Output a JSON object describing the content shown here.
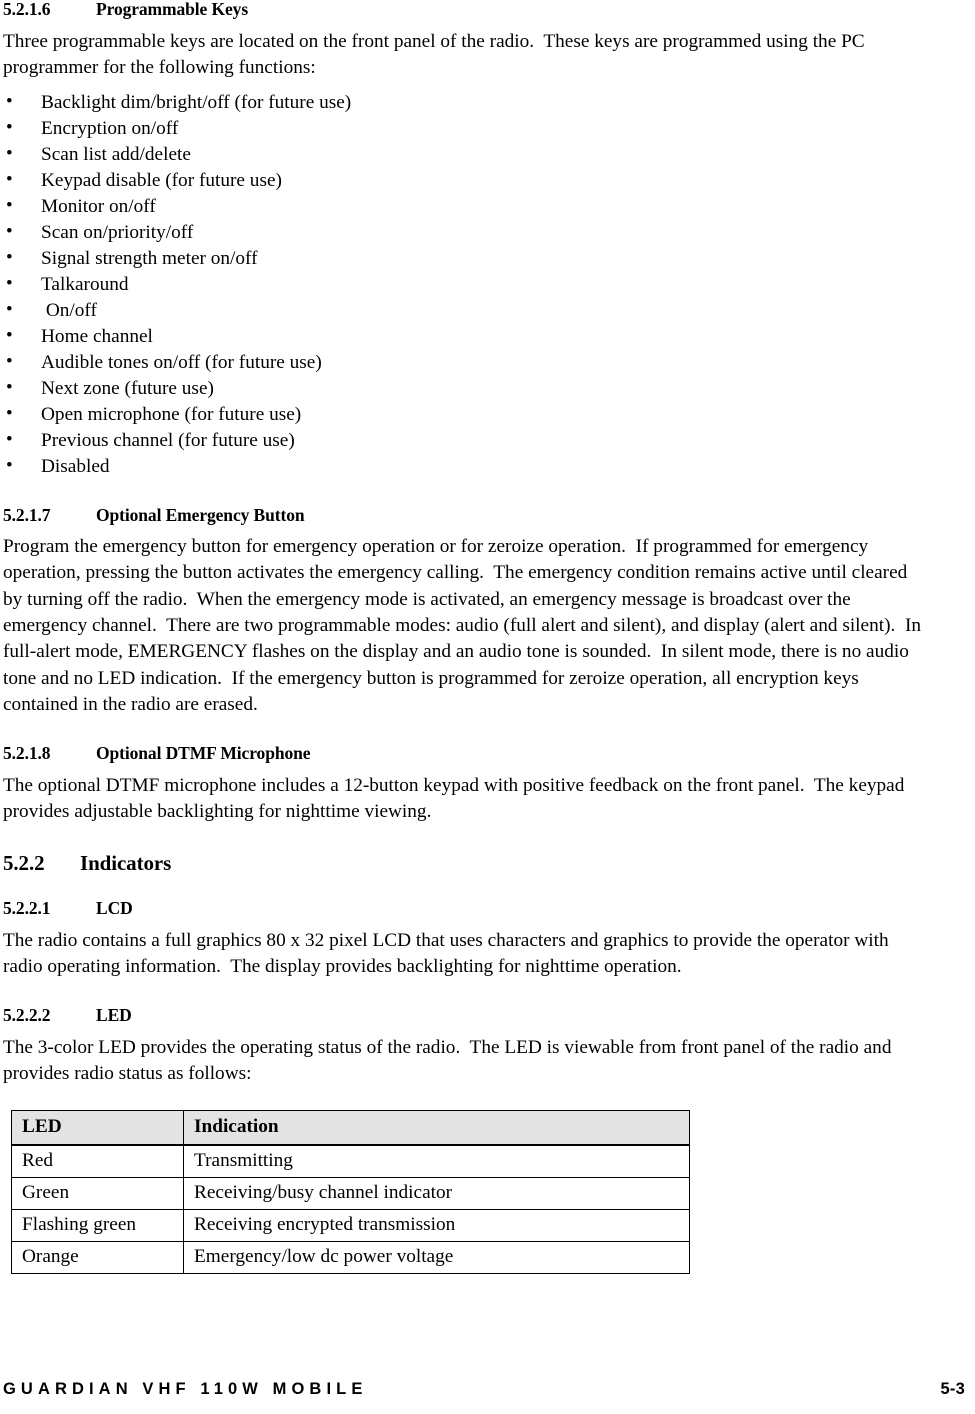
{
  "document": {
    "sections": [
      {
        "id": "5.2.1.6",
        "number": "5.2.1.6",
        "title": "Programmable Keys",
        "level": 3,
        "intro": "Three programmable keys are located on the front panel of the radio.  These keys are programmed using the PC programmer for the following functions:",
        "bullets": [
          "Backlight dim/bright/off (for future use)",
          "Encryption on/off",
          "Scan list add/delete",
          "Keypad disable (for future use)",
          "Monitor on/off",
          "Scan on/priority/off",
          "Signal strength meter on/off",
          "Talkaround",
          " On/off",
          "Home channel",
          "Audible tones on/off (for future use)",
          "Next zone (future use)",
          "Open microphone (for future use)",
          "Previous channel (for future use)",
          "Disabled"
        ]
      },
      {
        "id": "5.2.1.7",
        "number": "5.2.1.7",
        "title": "Optional Emergency Button",
        "level": 3,
        "body": "Program the emergency button for emergency operation or for zeroize operation.  If programmed for emergency operation, pressing the button activates the emergency calling.  The emergency condition remains active until cleared by turning off the radio.  When the emergency mode is activated, an emergency message is broadcast over the emergency channel.  There are two programmable modes: audio (full alert and silent), and display (alert and silent).  In full-alert mode, EMERGENCY flashes on the display and an audio tone is sounded.  In silent mode, there is no audio tone and no LED indication.  If the emergency button is programmed for zeroize operation, all encryption keys contained in the radio are erased."
      },
      {
        "id": "5.2.1.8",
        "number": "5.2.1.8",
        "title": "Optional DTMF Microphone",
        "level": 3,
        "body": "The optional DTMF microphone includes a 12-button keypad with positive feedback on the front panel.  The keypad provides adjustable backlighting for nighttime viewing."
      },
      {
        "id": "5.2.2",
        "number": "5.2.2",
        "title": "Indicators",
        "level": 2
      },
      {
        "id": "5.2.2.1",
        "number": "5.2.2.1",
        "title": "LCD",
        "level": 3,
        "body": "The radio contains a full graphics 80 x 32 pixel LCD that uses characters and graphics to provide the operator with radio operating information.  The display provides backlighting for nighttime operation."
      },
      {
        "id": "5.2.2.2",
        "number": "5.2.2.2",
        "title": "LED",
        "level": 3,
        "body": "The 3-color LED provides the operating status of the radio.  The LED is viewable from front panel of the radio and provides radio status as follows:"
      }
    ],
    "led_table": {
      "headers": [
        "LED",
        "Indication"
      ],
      "rows": [
        [
          "Red",
          "Transmitting"
        ],
        [
          "Green",
          "Receiving/busy channel indicator"
        ],
        [
          "Flashing green",
          "Receiving encrypted transmission"
        ],
        [
          "Orange",
          "Emergency/low dc power voltage"
        ]
      ],
      "header_fill": "#e3e3e3",
      "border_color": "#000000"
    },
    "footer": {
      "doc_title": "GUARDIAN VHF 110W MOBILE",
      "page_number": "5-3"
    }
  }
}
